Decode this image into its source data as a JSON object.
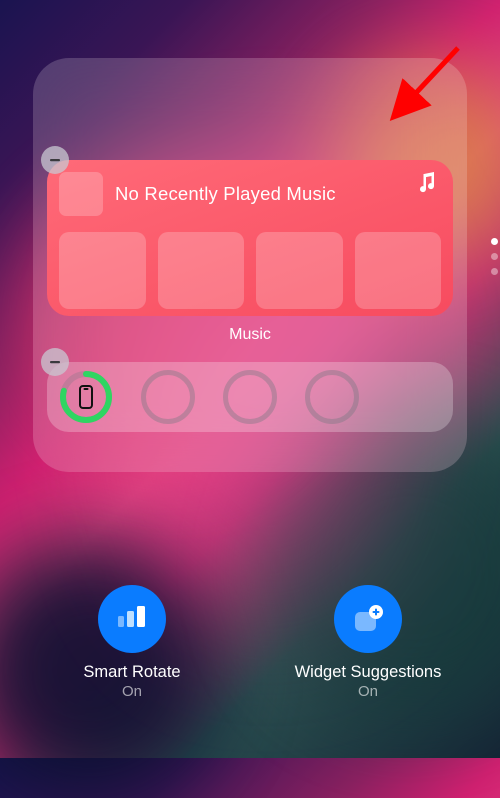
{
  "widgets": {
    "music": {
      "message": "No Recently Played Music",
      "label": "Music"
    }
  },
  "options": {
    "smart_rotate": {
      "label": "Smart Rotate",
      "status": "On"
    },
    "widget_suggestions": {
      "label": "Widget Suggestions",
      "status": "On"
    }
  }
}
